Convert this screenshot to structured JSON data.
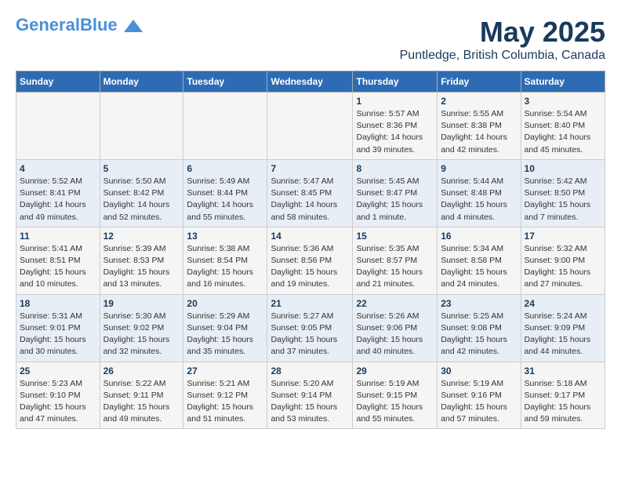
{
  "header": {
    "logo_general": "General",
    "logo_blue": "Blue",
    "title": "May 2025",
    "subtitle": "Puntledge, British Columbia, Canada"
  },
  "days_of_week": [
    "Sunday",
    "Monday",
    "Tuesday",
    "Wednesday",
    "Thursday",
    "Friday",
    "Saturday"
  ],
  "weeks": [
    [
      {
        "day": "",
        "info": ""
      },
      {
        "day": "",
        "info": ""
      },
      {
        "day": "",
        "info": ""
      },
      {
        "day": "",
        "info": ""
      },
      {
        "day": "1",
        "info": "Sunrise: 5:57 AM\nSunset: 8:36 PM\nDaylight: 14 hours\nand 39 minutes."
      },
      {
        "day": "2",
        "info": "Sunrise: 5:55 AM\nSunset: 8:38 PM\nDaylight: 14 hours\nand 42 minutes."
      },
      {
        "day": "3",
        "info": "Sunrise: 5:54 AM\nSunset: 8:40 PM\nDaylight: 14 hours\nand 45 minutes."
      }
    ],
    [
      {
        "day": "4",
        "info": "Sunrise: 5:52 AM\nSunset: 8:41 PM\nDaylight: 14 hours\nand 49 minutes."
      },
      {
        "day": "5",
        "info": "Sunrise: 5:50 AM\nSunset: 8:42 PM\nDaylight: 14 hours\nand 52 minutes."
      },
      {
        "day": "6",
        "info": "Sunrise: 5:49 AM\nSunset: 8:44 PM\nDaylight: 14 hours\nand 55 minutes."
      },
      {
        "day": "7",
        "info": "Sunrise: 5:47 AM\nSunset: 8:45 PM\nDaylight: 14 hours\nand 58 minutes."
      },
      {
        "day": "8",
        "info": "Sunrise: 5:45 AM\nSunset: 8:47 PM\nDaylight: 15 hours\nand 1 minute."
      },
      {
        "day": "9",
        "info": "Sunrise: 5:44 AM\nSunset: 8:48 PM\nDaylight: 15 hours\nand 4 minutes."
      },
      {
        "day": "10",
        "info": "Sunrise: 5:42 AM\nSunset: 8:50 PM\nDaylight: 15 hours\nand 7 minutes."
      }
    ],
    [
      {
        "day": "11",
        "info": "Sunrise: 5:41 AM\nSunset: 8:51 PM\nDaylight: 15 hours\nand 10 minutes."
      },
      {
        "day": "12",
        "info": "Sunrise: 5:39 AM\nSunset: 8:53 PM\nDaylight: 15 hours\nand 13 minutes."
      },
      {
        "day": "13",
        "info": "Sunrise: 5:38 AM\nSunset: 8:54 PM\nDaylight: 15 hours\nand 16 minutes."
      },
      {
        "day": "14",
        "info": "Sunrise: 5:36 AM\nSunset: 8:56 PM\nDaylight: 15 hours\nand 19 minutes."
      },
      {
        "day": "15",
        "info": "Sunrise: 5:35 AM\nSunset: 8:57 PM\nDaylight: 15 hours\nand 21 minutes."
      },
      {
        "day": "16",
        "info": "Sunrise: 5:34 AM\nSunset: 8:58 PM\nDaylight: 15 hours\nand 24 minutes."
      },
      {
        "day": "17",
        "info": "Sunrise: 5:32 AM\nSunset: 9:00 PM\nDaylight: 15 hours\nand 27 minutes."
      }
    ],
    [
      {
        "day": "18",
        "info": "Sunrise: 5:31 AM\nSunset: 9:01 PM\nDaylight: 15 hours\nand 30 minutes."
      },
      {
        "day": "19",
        "info": "Sunrise: 5:30 AM\nSunset: 9:02 PM\nDaylight: 15 hours\nand 32 minutes."
      },
      {
        "day": "20",
        "info": "Sunrise: 5:29 AM\nSunset: 9:04 PM\nDaylight: 15 hours\nand 35 minutes."
      },
      {
        "day": "21",
        "info": "Sunrise: 5:27 AM\nSunset: 9:05 PM\nDaylight: 15 hours\nand 37 minutes."
      },
      {
        "day": "22",
        "info": "Sunrise: 5:26 AM\nSunset: 9:06 PM\nDaylight: 15 hours\nand 40 minutes."
      },
      {
        "day": "23",
        "info": "Sunrise: 5:25 AM\nSunset: 9:08 PM\nDaylight: 15 hours\nand 42 minutes."
      },
      {
        "day": "24",
        "info": "Sunrise: 5:24 AM\nSunset: 9:09 PM\nDaylight: 15 hours\nand 44 minutes."
      }
    ],
    [
      {
        "day": "25",
        "info": "Sunrise: 5:23 AM\nSunset: 9:10 PM\nDaylight: 15 hours\nand 47 minutes."
      },
      {
        "day": "26",
        "info": "Sunrise: 5:22 AM\nSunset: 9:11 PM\nDaylight: 15 hours\nand 49 minutes."
      },
      {
        "day": "27",
        "info": "Sunrise: 5:21 AM\nSunset: 9:12 PM\nDaylight: 15 hours\nand 51 minutes."
      },
      {
        "day": "28",
        "info": "Sunrise: 5:20 AM\nSunset: 9:14 PM\nDaylight: 15 hours\nand 53 minutes."
      },
      {
        "day": "29",
        "info": "Sunrise: 5:19 AM\nSunset: 9:15 PM\nDaylight: 15 hours\nand 55 minutes."
      },
      {
        "day": "30",
        "info": "Sunrise: 5:19 AM\nSunset: 9:16 PM\nDaylight: 15 hours\nand 57 minutes."
      },
      {
        "day": "31",
        "info": "Sunrise: 5:18 AM\nSunset: 9:17 PM\nDaylight: 15 hours\nand 59 minutes."
      }
    ]
  ]
}
